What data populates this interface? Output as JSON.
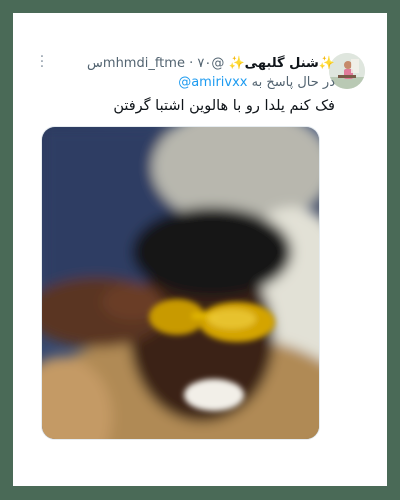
{
  "tweet": {
    "display_name": "شنل گلبهی",
    "sparkle_left": "✨",
    "sparkle_right": "✨",
    "handle": "@mhmdi_ftme",
    "separator": "·",
    "time": "۷۰س",
    "more_icon": "more-dots-icon",
    "reply_prefix": "در حال پاسخ به",
    "reply_handle": "@amirivxx",
    "text": "فک کنم یلدا رو با هالوین اشتبا گرفتن",
    "media_image": "blurry-man-gold-glasses-photo"
  },
  "colors": {
    "background_frame": "#4a6a57",
    "card": "#ffffff",
    "link": "#1d9bf0",
    "secondary_text": "#536471",
    "primary_text": "#0f1419"
  }
}
